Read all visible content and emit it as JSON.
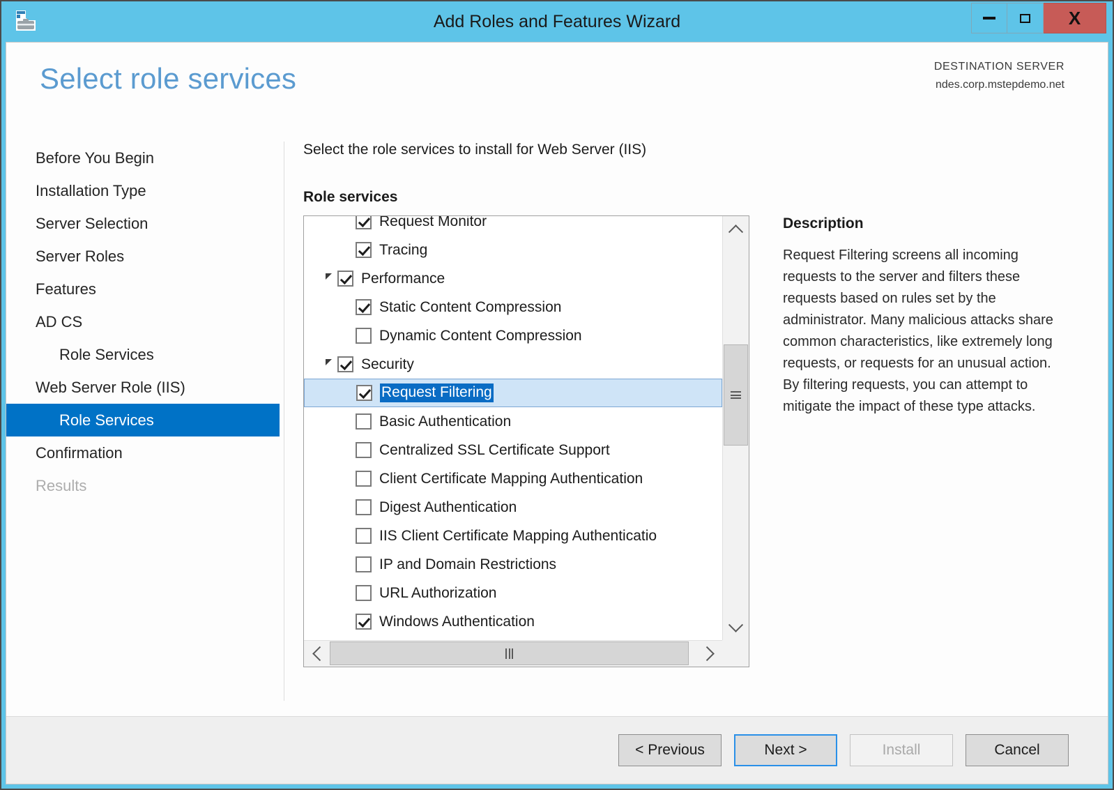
{
  "window": {
    "title": "Add Roles and Features Wizard",
    "icon": "server-wizard-icon",
    "buttons": {
      "minimize": "minimize-icon",
      "maximize": "maximize-icon",
      "close": "X"
    }
  },
  "header": {
    "page_title": "Select role services",
    "destination_label": "DESTINATION SERVER",
    "destination_server": "ndes.corp.mstepdemo.net"
  },
  "sidebar": {
    "items": [
      {
        "label": "Before You Begin",
        "level": 0,
        "state": "normal"
      },
      {
        "label": "Installation Type",
        "level": 0,
        "state": "normal"
      },
      {
        "label": "Server Selection",
        "level": 0,
        "state": "normal"
      },
      {
        "label": "Server Roles",
        "level": 0,
        "state": "normal"
      },
      {
        "label": "Features",
        "level": 0,
        "state": "normal"
      },
      {
        "label": "AD CS",
        "level": 0,
        "state": "normal"
      },
      {
        "label": "Role Services",
        "level": 1,
        "state": "normal"
      },
      {
        "label": "Web Server Role (IIS)",
        "level": 0,
        "state": "normal"
      },
      {
        "label": "Role Services",
        "level": 1,
        "state": "selected"
      },
      {
        "label": "Confirmation",
        "level": 0,
        "state": "normal"
      },
      {
        "label": "Results",
        "level": 0,
        "state": "disabled"
      }
    ]
  },
  "main": {
    "instruction": "Select the role services to install for Web Server (IIS)",
    "section_label": "Role services",
    "tree": [
      {
        "label": "Request Monitor",
        "indent": 2,
        "checked": true,
        "expander": false,
        "selected": false,
        "clipped": true
      },
      {
        "label": "Tracing",
        "indent": 2,
        "checked": true,
        "expander": false,
        "selected": false
      },
      {
        "label": "Performance",
        "indent": 1,
        "checked": true,
        "expander": true,
        "selected": false
      },
      {
        "label": "Static Content Compression",
        "indent": 2,
        "checked": true,
        "expander": false,
        "selected": false
      },
      {
        "label": "Dynamic Content Compression",
        "indent": 2,
        "checked": false,
        "expander": false,
        "selected": false
      },
      {
        "label": "Security",
        "indent": 1,
        "checked": true,
        "expander": true,
        "selected": false
      },
      {
        "label": "Request Filtering",
        "indent": 2,
        "checked": true,
        "expander": false,
        "selected": true
      },
      {
        "label": "Basic Authentication",
        "indent": 2,
        "checked": false,
        "expander": false,
        "selected": false
      },
      {
        "label": "Centralized SSL Certificate Support",
        "indent": 2,
        "checked": false,
        "expander": false,
        "selected": false
      },
      {
        "label": "Client Certificate Mapping Authentication",
        "indent": 2,
        "checked": false,
        "expander": false,
        "selected": false
      },
      {
        "label": "Digest Authentication",
        "indent": 2,
        "checked": false,
        "expander": false,
        "selected": false
      },
      {
        "label": "IIS Client Certificate Mapping Authenticatio",
        "indent": 2,
        "checked": false,
        "expander": false,
        "selected": false
      },
      {
        "label": "IP and Domain Restrictions",
        "indent": 2,
        "checked": false,
        "expander": false,
        "selected": false
      },
      {
        "label": "URL Authorization",
        "indent": 2,
        "checked": false,
        "expander": false,
        "selected": false
      },
      {
        "label": "Windows Authentication",
        "indent": 2,
        "checked": true,
        "expander": false,
        "selected": false
      }
    ]
  },
  "description": {
    "title": "Description",
    "body": "Request Filtering screens all incoming requests to the server and filters these requests based on rules set by the administrator. Many malicious attacks share common characteristics, like extremely long requests, or requests for an unusual action. By filtering requests, you can attempt to mitigate the impact of these type attacks."
  },
  "footer": {
    "previous": "< Previous",
    "next": "Next >",
    "install": "Install",
    "cancel": "Cancel"
  },
  "colors": {
    "titlebar": "#5ec4e8",
    "accent": "#0072c6",
    "page_title": "#5b9bd0",
    "selection_row": "#cfe4f7",
    "selection_text": "#0a6cc4",
    "close_button": "#c75b57"
  }
}
